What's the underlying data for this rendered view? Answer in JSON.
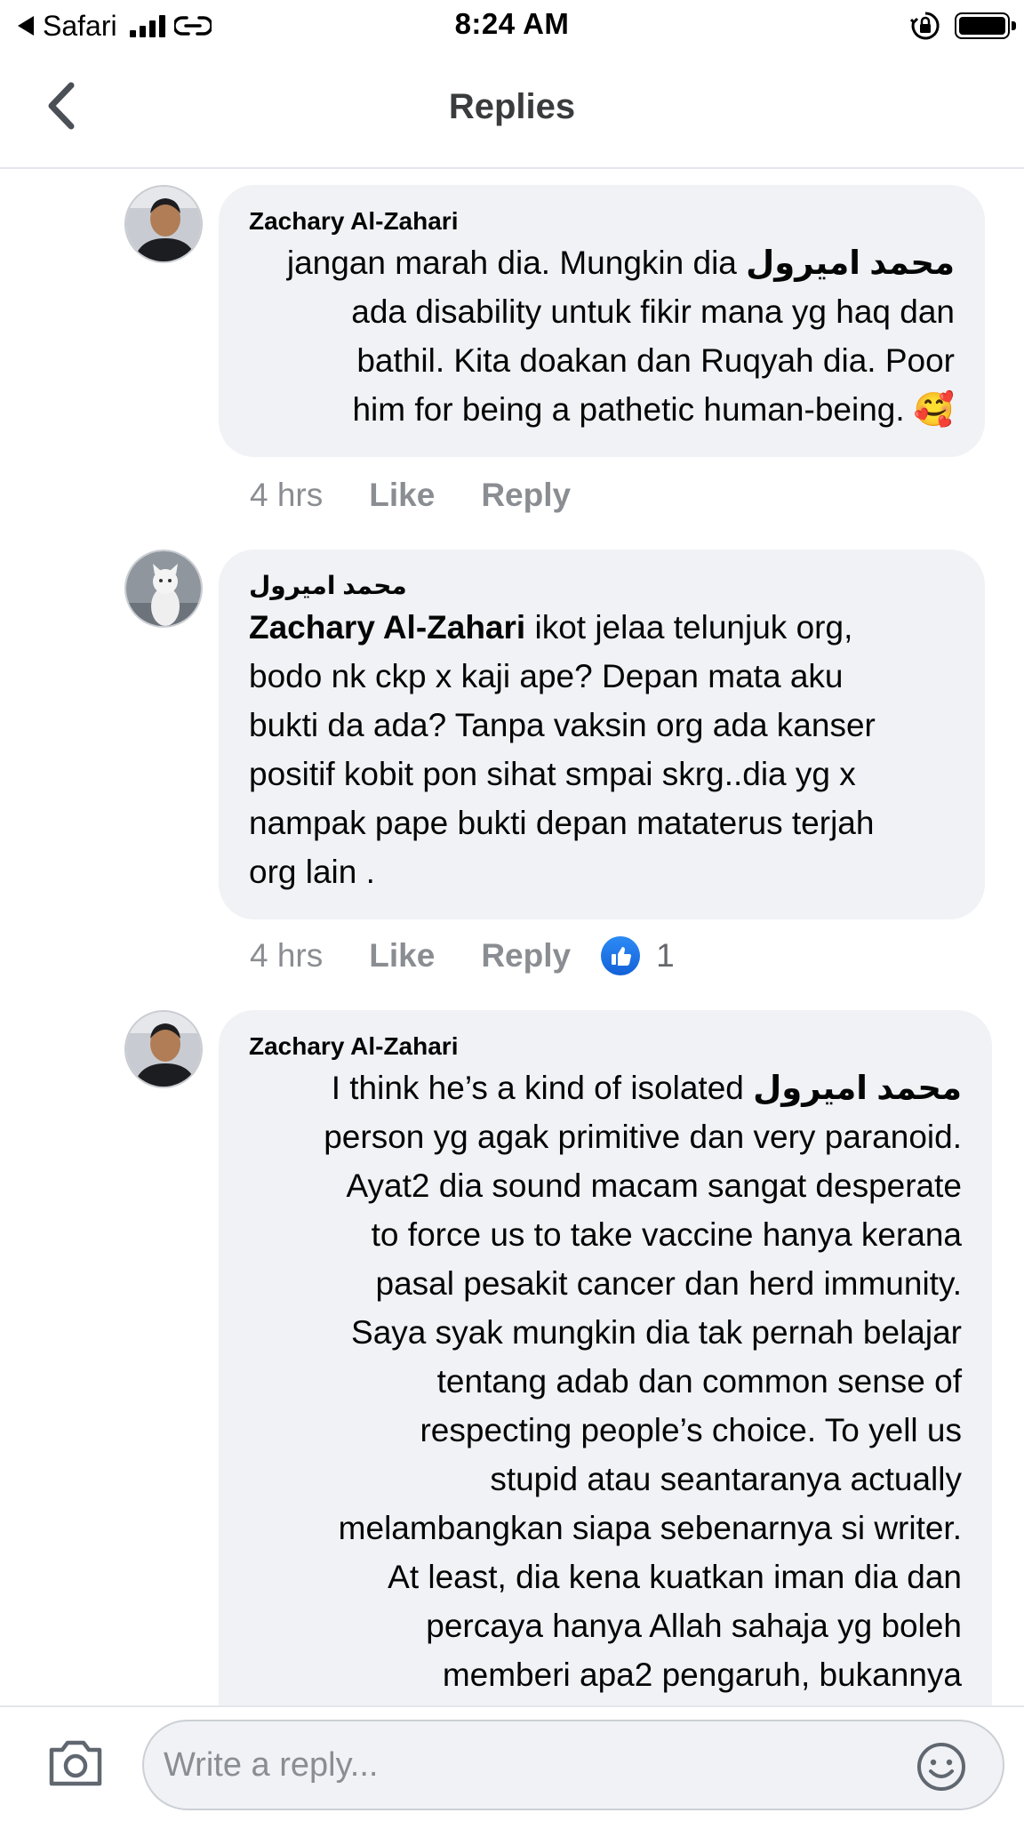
{
  "status_bar": {
    "carrier": "Safari",
    "time": "8:24 AM"
  },
  "header": {
    "title": "Replies"
  },
  "comments": [
    {
      "author": "Zachary Al-Zahari",
      "lines": [
        [
          "jangan marah dia. Mungkin dia ",
          "محمد اميرول"
        ],
        "ada disability untuk fikir mana yg haq dan",
        "bathil. Kita doakan dan Ruqyah dia. Poor",
        [
          "him for being a pathetic human-being. ",
          "🥰"
        ]
      ],
      "time": "4 hrs",
      "like_label": "Like",
      "reply_label": "Reply"
    },
    {
      "author": "محمد اميرول",
      "mention": "Zachary Al-Zahari",
      "lines": [
        " ikot jelaa telunjuk org,",
        "bodo nk ckp x kaji ape? Depan mata aku",
        "bukti da ada? Tanpa vaksin org ada kanser",
        "positif kobit pon sihat smpai skrg..dia yg x",
        "nampak pape bukti depan mataterus terjah",
        "org lain ."
      ],
      "time": "4 hrs",
      "like_label": "Like",
      "reply_label": "Reply",
      "reaction_count": "1"
    },
    {
      "author": "Zachary Al-Zahari",
      "lines": [
        [
          "I think he’s a kind of isolated ",
          "محمد اميرول"
        ],
        "person yg agak primitive dan very paranoid.",
        "Ayat2 dia sound macam sangat desperate",
        "to force us to take vaccine hanya kerana",
        "pasal pesakit cancer dan herd immunity.",
        "Saya syak mungkin dia tak pernah belajar",
        "tentang adab dan common sense of",
        "respecting people’s choice. To yell us",
        "stupid atau seantaranya actually",
        "melambangkan siapa sebenarnya si writer.",
        "At least, dia kena kuatkan iman dia dan",
        "percaya hanya Allah sahaja yg boleh",
        "memberi apa2 pengaruh, bukannya"
      ]
    }
  ],
  "composer": {
    "placeholder": "Write a reply..."
  }
}
